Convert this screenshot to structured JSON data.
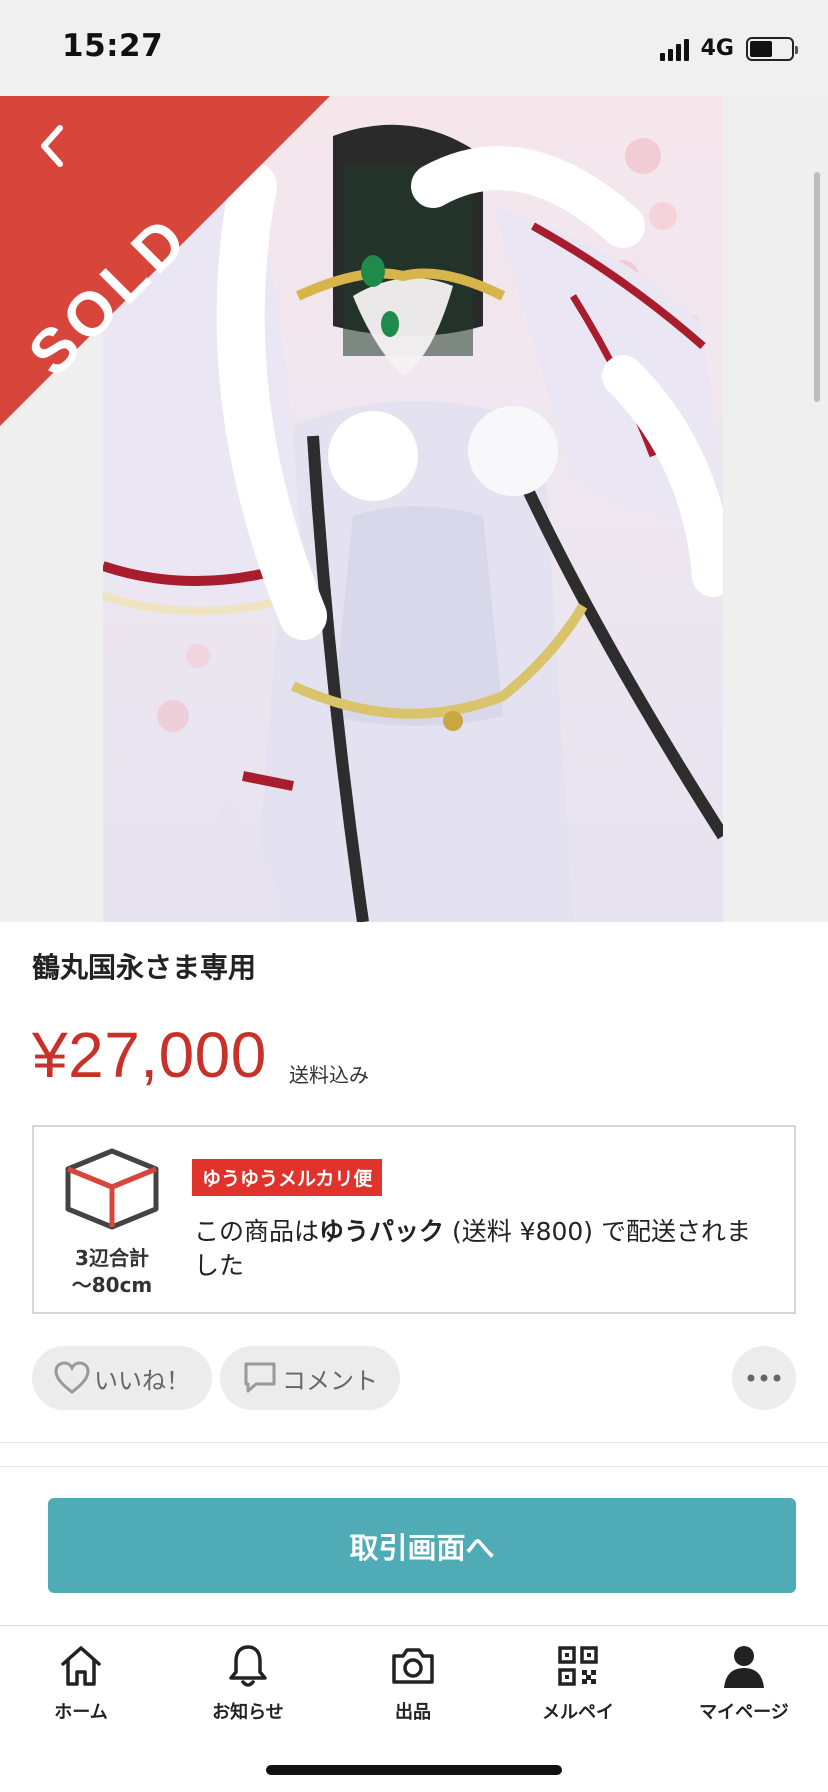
{
  "status_bar": {
    "time": "15:27",
    "network": "4G",
    "battery_level": 0.55
  },
  "photo": {
    "sold_label": "SOLD",
    "sold_ribbon_color": "#d8453a"
  },
  "product": {
    "title": "鶴丸国永さま専用",
    "price": "¥27,000",
    "price_note": "送料込み"
  },
  "shipping": {
    "badge": "ゆうゆうメルカリ便",
    "size_line1": "3辺合計",
    "size_line2": "〜80cm",
    "text_before": "この商品は",
    "method": "ゆうパック",
    "text_after": " (送料 ¥800) で配送されました"
  },
  "actions": {
    "like_label": "いいね！",
    "comment_label": "コメント"
  },
  "cta": {
    "label": "取引画面へ",
    "color": "#4fabb5"
  },
  "nav": {
    "items": [
      {
        "label": "ホーム",
        "icon": "home-icon"
      },
      {
        "label": "お知らせ",
        "icon": "bell-icon"
      },
      {
        "label": "出品",
        "icon": "camera-icon"
      },
      {
        "label": "メルペイ",
        "icon": "qr-code-icon"
      },
      {
        "label": "マイページ",
        "icon": "person-icon"
      }
    ]
  },
  "colors": {
    "price": "#c8302a",
    "badge": "#e0332b"
  }
}
